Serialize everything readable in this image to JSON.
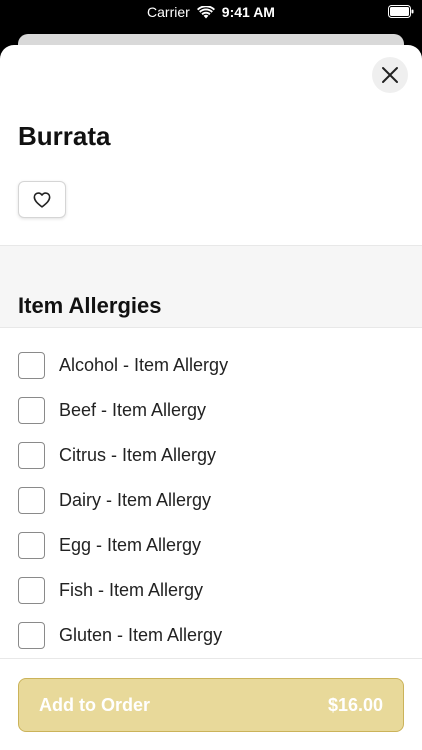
{
  "status_bar": {
    "carrier": "Carrier",
    "time": "9:41 AM"
  },
  "item": {
    "name": "Burrata"
  },
  "section": {
    "title": "Item Allergies"
  },
  "allergies": [
    {
      "label": "Alcohol - Item Allergy",
      "checked": false
    },
    {
      "label": "Beef - Item Allergy",
      "checked": false
    },
    {
      "label": "Citrus - Item Allergy",
      "checked": false
    },
    {
      "label": "Dairy - Item Allergy",
      "checked": false
    },
    {
      "label": "Egg - Item Allergy",
      "checked": false
    },
    {
      "label": "Fish - Item Allergy",
      "checked": false
    },
    {
      "label": "Gluten - Item Allergy",
      "checked": false
    }
  ],
  "footer": {
    "add_label": "Add to Order",
    "price": "$16.00"
  },
  "colors": {
    "button_bg": "#e8d99a",
    "button_border": "#cbb35a"
  },
  "icons": {
    "close": "close-icon",
    "favorite": "heart-icon",
    "wifi": "wifi-icon",
    "battery": "battery-icon"
  }
}
